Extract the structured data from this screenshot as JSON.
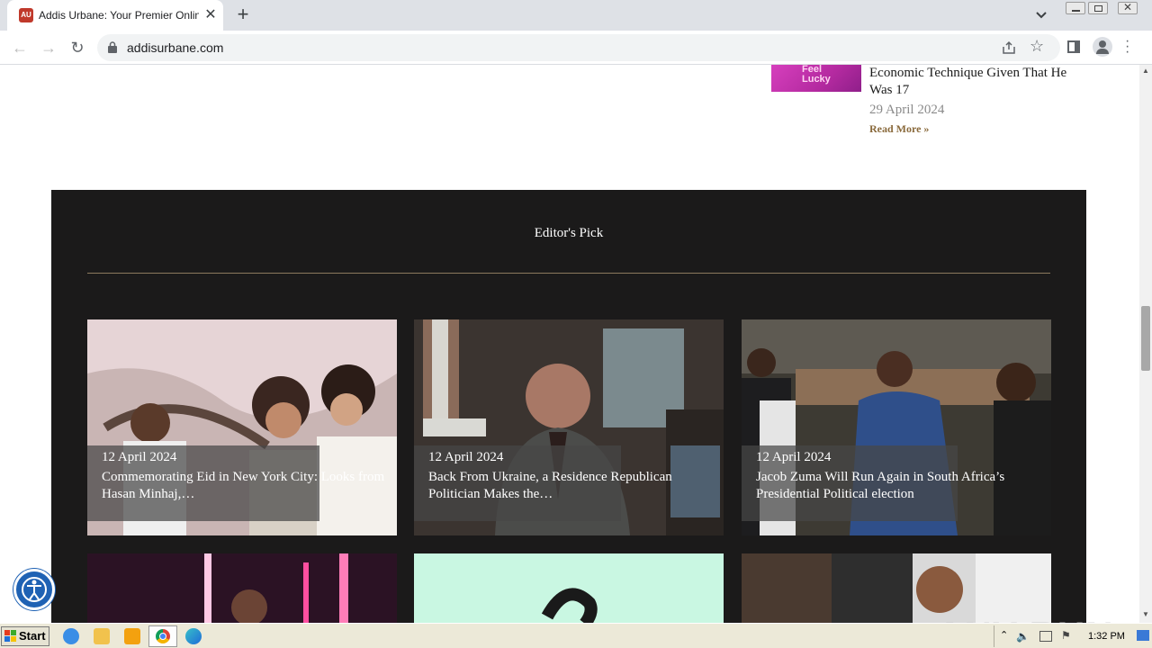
{
  "browser": {
    "tab_title": "Addis Urbane: Your Premier Online N",
    "url": "addisurbane.com",
    "icons": [
      "back-arrow-icon",
      "forward-arrow-icon",
      "reload-icon",
      "lock-icon",
      "share-icon",
      "star-icon",
      "sidepanel-icon",
      "profile-icon",
      "kebab-menu-icon"
    ]
  },
  "sidebar_article": {
    "thumb_text": "Feel\nLucky",
    "title": "Economic Technique Given That He Was 17",
    "date": "29 April 2024",
    "read_more": "Read More »"
  },
  "editors_pick": {
    "heading": "Editor's Pick",
    "cards": [
      {
        "date": "12 April 2024",
        "title": "Commemorating Eid in New York City: Looks from Hasan Minhaj,…"
      },
      {
        "date": "12 April 2024",
        "title": "Back From Ukraine, a Residence Republican Politician Makes the…"
      },
      {
        "date": "12 April 2024",
        "title": "Jacob Zuma Will Run Again in South Africa’s Presidential Political election"
      }
    ]
  },
  "watermark": "ANY RUN",
  "taskbar": {
    "start_label": "Start",
    "clock": "1:32 PM"
  },
  "colors": {
    "editor_bg": "#1b1a1a",
    "accent_gold": "#8c7a5e",
    "read_more": "#8a6a3c"
  }
}
